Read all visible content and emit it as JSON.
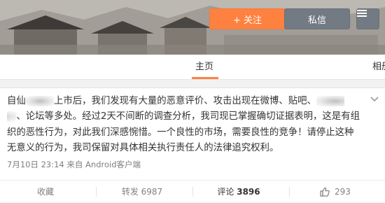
{
  "header": {
    "follow_label": "+ 关注",
    "message_label": "私信",
    "more_icon": "menu-icon"
  },
  "nav": {
    "home_label": "主页",
    "right_label": "相册"
  },
  "post": {
    "segments": [
      "自仙",
      "",
      "上市后，我们发现有大量的恶意评价、攻击出现在微博、贴吧、",
      "",
      "、论坛等多处。经过2天不间断的调查分析，我司现已掌握确切证据表明，这是有组织的恶性行为，对此我们深感惋惜。一个良性的市场，需要良性的竞争！请停止这种无意义的行为，我司保留对具体相关执行责任人的法律追究权利。"
    ],
    "meta": "7月10日 23:14 来自 Android客户端"
  },
  "actions": {
    "favorite": "收藏",
    "forward": "转发 6987",
    "comment_label": "评论",
    "comment_count": "3896",
    "like_count": "293"
  },
  "colors": {
    "accent": "#ff8140",
    "button_gray": "#727a83"
  }
}
